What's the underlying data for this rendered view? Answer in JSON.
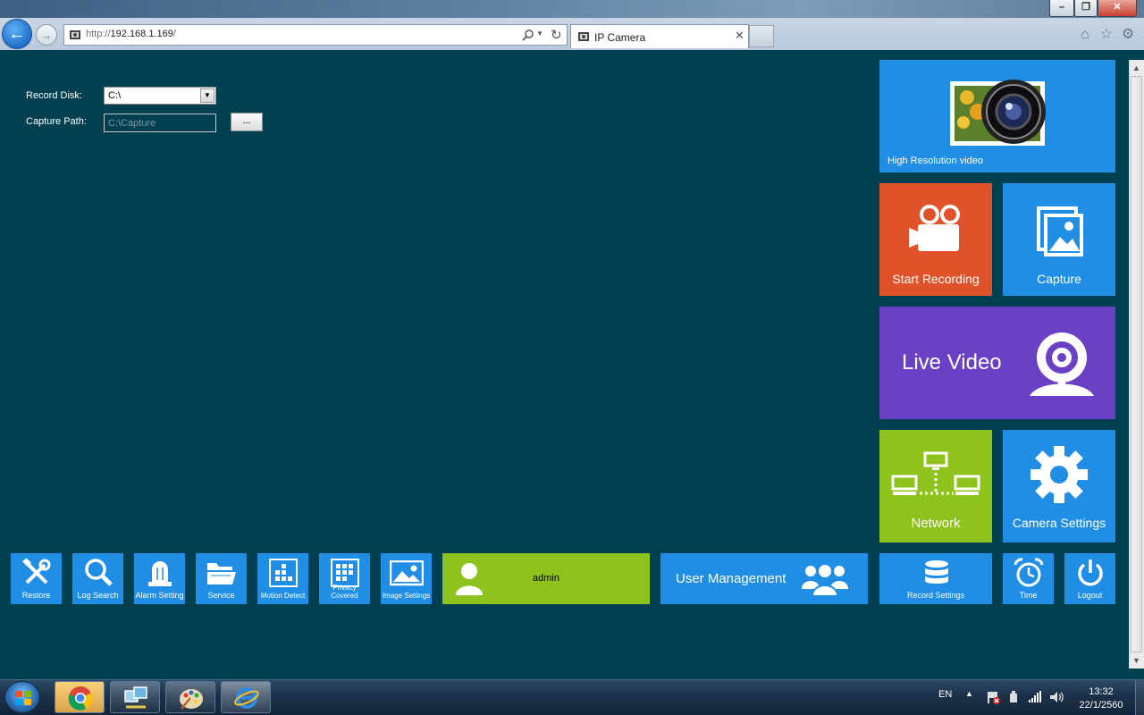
{
  "browser": {
    "url_prefix": "http://",
    "url_host": "192.168.1.169",
    "url_suffix": "/",
    "tab_title": "IP Camera"
  },
  "form": {
    "record_disk_label": "Record Disk:",
    "record_disk_value": "C:\\",
    "capture_path_label": "Capture Path:",
    "capture_path_placeholder": "C:\\Capture",
    "browse_label": "..."
  },
  "tiles": {
    "high_res": "High Resolution video",
    "start_recording": "Start Recording",
    "capture": "Capture",
    "live_video": "Live Video",
    "network": "Network",
    "camera_settings": "Camera Settings"
  },
  "toolbar": {
    "restore": "Restore",
    "log_search": "Log Search",
    "alarm_setting": "Alarm Setting",
    "service": "Service",
    "motion_detect": "Motion Detect",
    "privacy_covered": "Privacy Covered",
    "image_settings": "Image Settings",
    "admin": "admin",
    "user_management": "User Management",
    "record_settings": "Record Settings",
    "time": "Time",
    "logout": "Logout"
  },
  "taskbar": {
    "language": "EN",
    "time": "13:32",
    "date": "22/1/2560"
  },
  "colors": {
    "background": "#004050",
    "tile_blue": "#218ee6",
    "tile_orange": "#e0522a",
    "tile_purple": "#6a41c5",
    "tile_green": "#8ec21c"
  }
}
